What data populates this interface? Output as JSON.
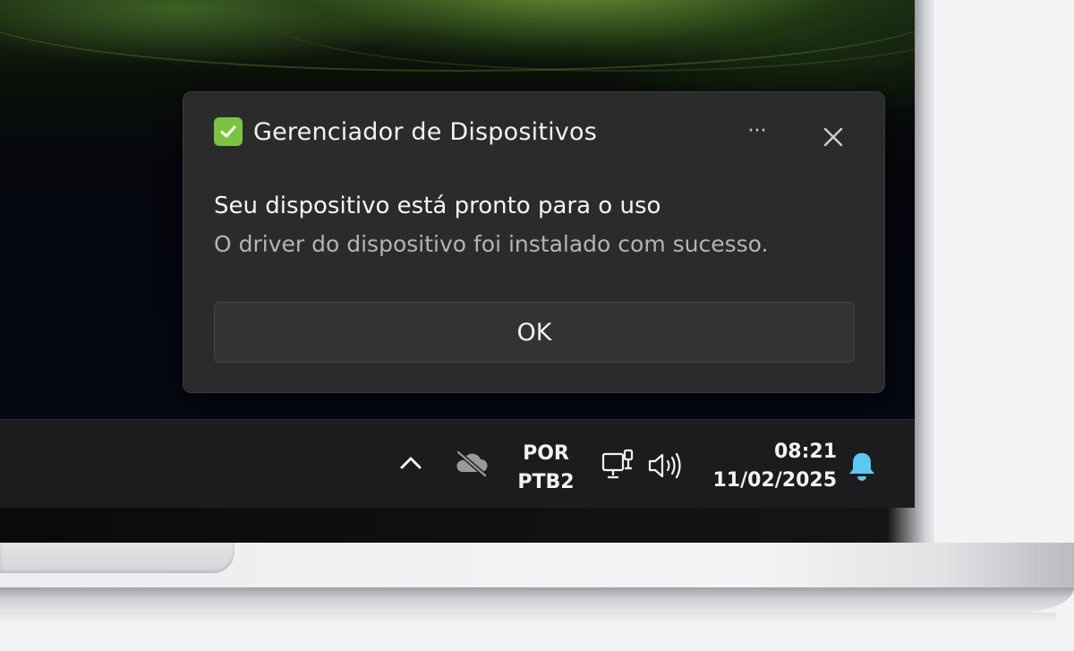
{
  "toast": {
    "app_icon": "check-mark-icon",
    "app_name": "Gerenciador de Dispositivos",
    "more_label": "···",
    "title": "Seu dispositivo está pronto para o uso",
    "message": "O driver do dispositivo foi instalado com sucesso.",
    "ok_label": "OK",
    "accent": "#7ac442"
  },
  "taskbar": {
    "language_line1": "POR",
    "language_line2": "PTB2",
    "time": "08:21",
    "date": "11/02/2025",
    "icons": [
      "chevron-up-icon",
      "cloud-off-icon",
      "network-icon",
      "volume-icon",
      "bell-icon"
    ],
    "bell_color": "#5cc8f0"
  }
}
